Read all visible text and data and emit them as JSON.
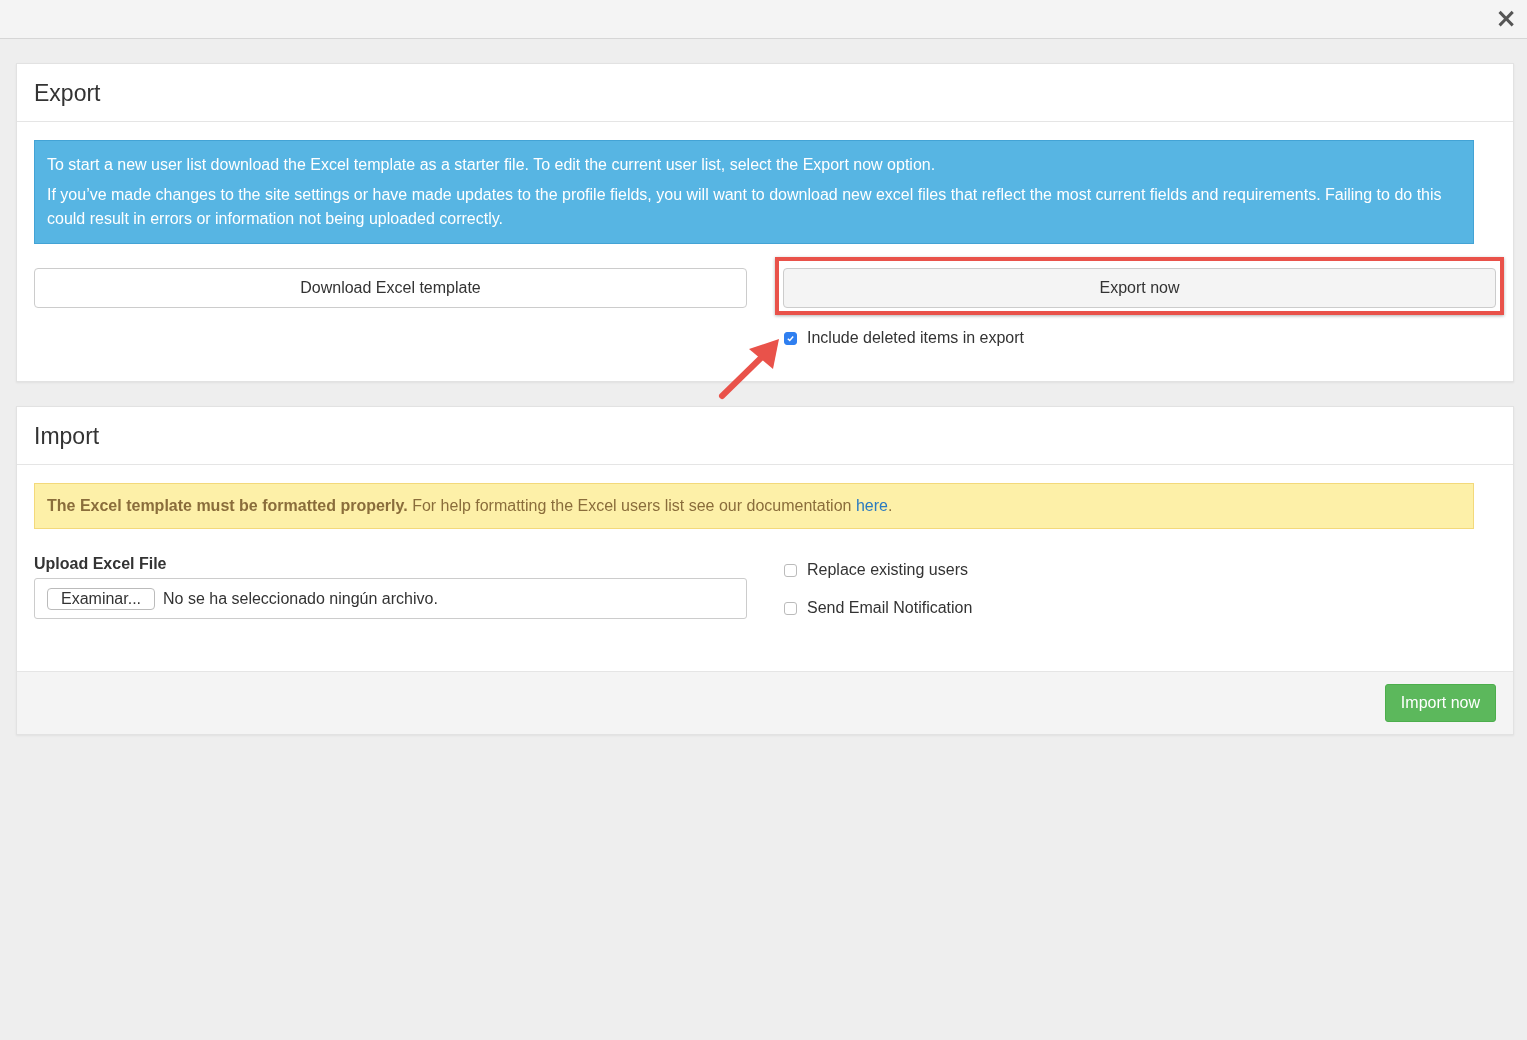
{
  "dialog": {
    "close": "×"
  },
  "export": {
    "title": "Export",
    "info": [
      "To start a new user list download the Excel template as a starter file. To edit the current user list, select the Export now option.",
      "If you’ve made changes to the site settings or have made updates to the profile fields, you will want to download new excel files that reflect the most current fields and requirements. Failing to do this could result in errors or information not being uploaded correctly."
    ],
    "download_button": "Download Excel template",
    "export_button": {
      "label": "Export now",
      "highlighted": true
    },
    "include_deleted": {
      "label": "Include deleted items in export",
      "checked": true,
      "arrow": true
    }
  },
  "import": {
    "title": "Import",
    "warning": {
      "message": "**The Excel template must be formatted properly.** For help formatting the Excel users list see our documentation",
      "link": "here",
      "end": "."
    },
    "upload": {
      "label": "Upload Excel File",
      "button": "Examinar...",
      "value": "No se ha seleccionado ningún archivo."
    },
    "options": [
      {
        "label": "Replace existing users",
        "checked": false
      },
      {
        "label": "Send Email Notification",
        "checked": false
      }
    ],
    "import_button": "Import now"
  }
}
